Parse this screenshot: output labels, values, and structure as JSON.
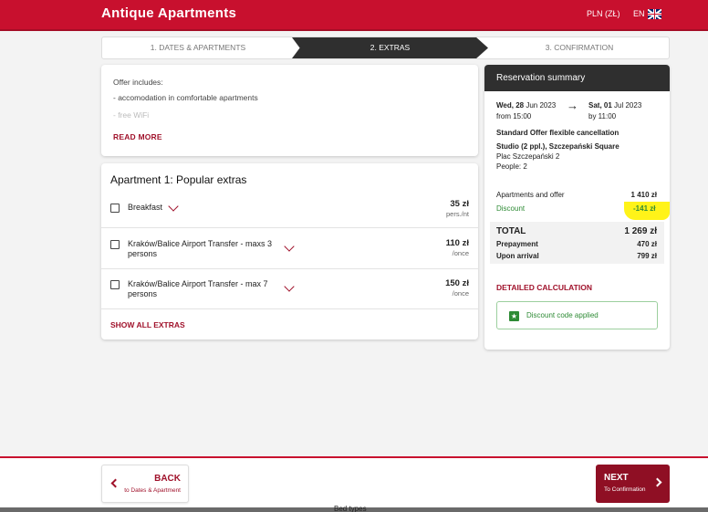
{
  "header": {
    "brand": "Antique Apartments",
    "currency": "PLN (ZŁ)",
    "language": "EN",
    "accent": "#c8102e"
  },
  "steps": [
    {
      "label": "1. DATES & APARTMENTS",
      "active": false
    },
    {
      "label": "2. EXTRAS",
      "active": true
    },
    {
      "label": "3. CONFIRMATION",
      "active": false
    }
  ],
  "offer": {
    "heading": "Offer includes:",
    "lines": [
      "- accomodation in comfortable apartments",
      "- free WiFi"
    ],
    "read_more": "READ MORE"
  },
  "extras": {
    "title": "Apartment 1: Popular extras",
    "items": [
      {
        "name": "Breakfast",
        "price": "35 zł",
        "unit": "pers./nt",
        "checked": false
      },
      {
        "name_line1": "Kraków/Balice Airport Transfer - maxs 3",
        "name_line2": "persons",
        "price": "110 zł",
        "unit": "/once",
        "checked": false
      },
      {
        "name_line1": "Kraków/Balice Airport Transfer - max 7",
        "name_line2": "persons",
        "price": "150 zł",
        "unit": "/once",
        "checked": false
      }
    ],
    "show_all": "SHOW ALL EXTRAS"
  },
  "summary": {
    "title": "Reservation summary",
    "checkin": {
      "day": "Wed, 28",
      "rest": " Jun 2023",
      "time": "from 15:00"
    },
    "checkout": {
      "day": "Sat, 01",
      "rest": " Jul 2023",
      "time": "by 11:00"
    },
    "offer_name": "Standard Offer flexible cancellation",
    "apartment": "Studio (2 ppl.), Szczepański Square",
    "address": "Plac Szczepański 2",
    "people": "People: 2",
    "apartments_label": "Apartments and offer",
    "apartments_value": "1 410 zł",
    "discount_label": "Discount",
    "discount_value": "-141 zł",
    "total_label": "TOTAL",
    "total_value": "1 269 zł",
    "prepayment_label": "Prepayment",
    "prepayment_value": "470 zł",
    "arrival_label": "Upon arrival",
    "arrival_value": "799 zł",
    "detailed": "DETAILED CALCULATION",
    "code_applied": "Discount code applied",
    "discount_color": "#2e8b35"
  },
  "nav": {
    "back": "BACK",
    "back_sub": "to Dates & Apartment",
    "next": "NEXT",
    "next_sub": "To Confirmation"
  },
  "background_text": "Bed types"
}
